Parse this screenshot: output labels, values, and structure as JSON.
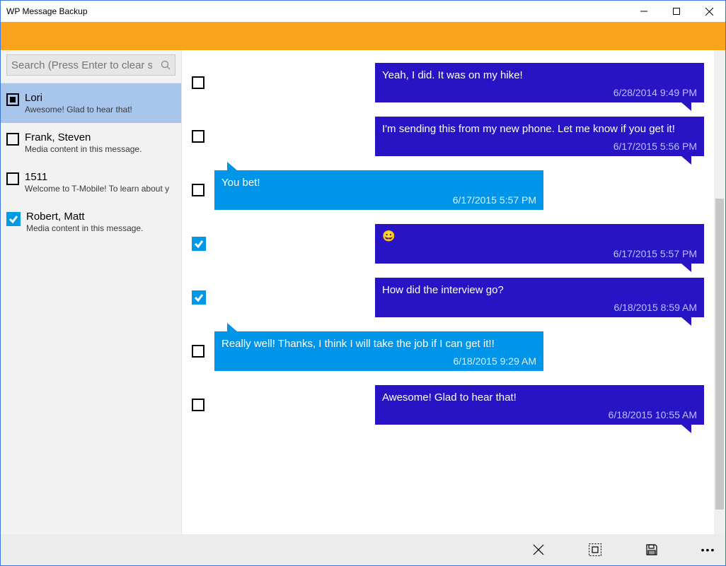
{
  "window": {
    "title": "WP Message Backup"
  },
  "colors": {
    "accent": "#F9A41C",
    "outgoing": "#2814C4",
    "incoming": "#0095E8",
    "selection": "#a8c6eb"
  },
  "search": {
    "placeholder": "Search (Press Enter to clear s"
  },
  "contacts": [
    {
      "name": "Lori",
      "preview": "Awesome! Glad to hear that!",
      "selected": true,
      "check": "filled"
    },
    {
      "name": "Frank, Steven",
      "preview": "Media content in this message.",
      "selected": false,
      "check": "empty"
    },
    {
      "name": "1511",
      "preview": "Welcome to T-Mobile! To learn about y",
      "selected": false,
      "check": "empty"
    },
    {
      "name": "Robert, Matt",
      "preview": "Media content in this message.",
      "selected": false,
      "check": "checked"
    }
  ],
  "messages": [
    {
      "dir": "outgoing",
      "text": "Yeah, I did. It was on my hike!",
      "ts": "6/28/2014 9:49 PM",
      "check": "empty"
    },
    {
      "dir": "outgoing",
      "text": "I'm sending this from my new phone. Let me know if you get it!",
      "ts": "6/17/2015 5:56 PM",
      "check": "empty"
    },
    {
      "dir": "incoming",
      "text": "You bet!",
      "ts": "6/17/2015 5:57 PM",
      "check": "empty"
    },
    {
      "dir": "outgoing",
      "text": "😀",
      "ts": "6/17/2015 5:57 PM",
      "check": "checked"
    },
    {
      "dir": "outgoing",
      "text": "How did the interview go?",
      "ts": "6/18/2015 8:59 AM",
      "check": "checked"
    },
    {
      "dir": "incoming",
      "text": "Really well! Thanks, I think I will take the job if I can get it!!",
      "ts": "6/18/2015 9:29 AM",
      "check": "empty"
    },
    {
      "dir": "outgoing",
      "text": "Awesome! Glad to hear that!",
      "ts": "6/18/2015 10:55 AM",
      "check": "empty"
    }
  ]
}
